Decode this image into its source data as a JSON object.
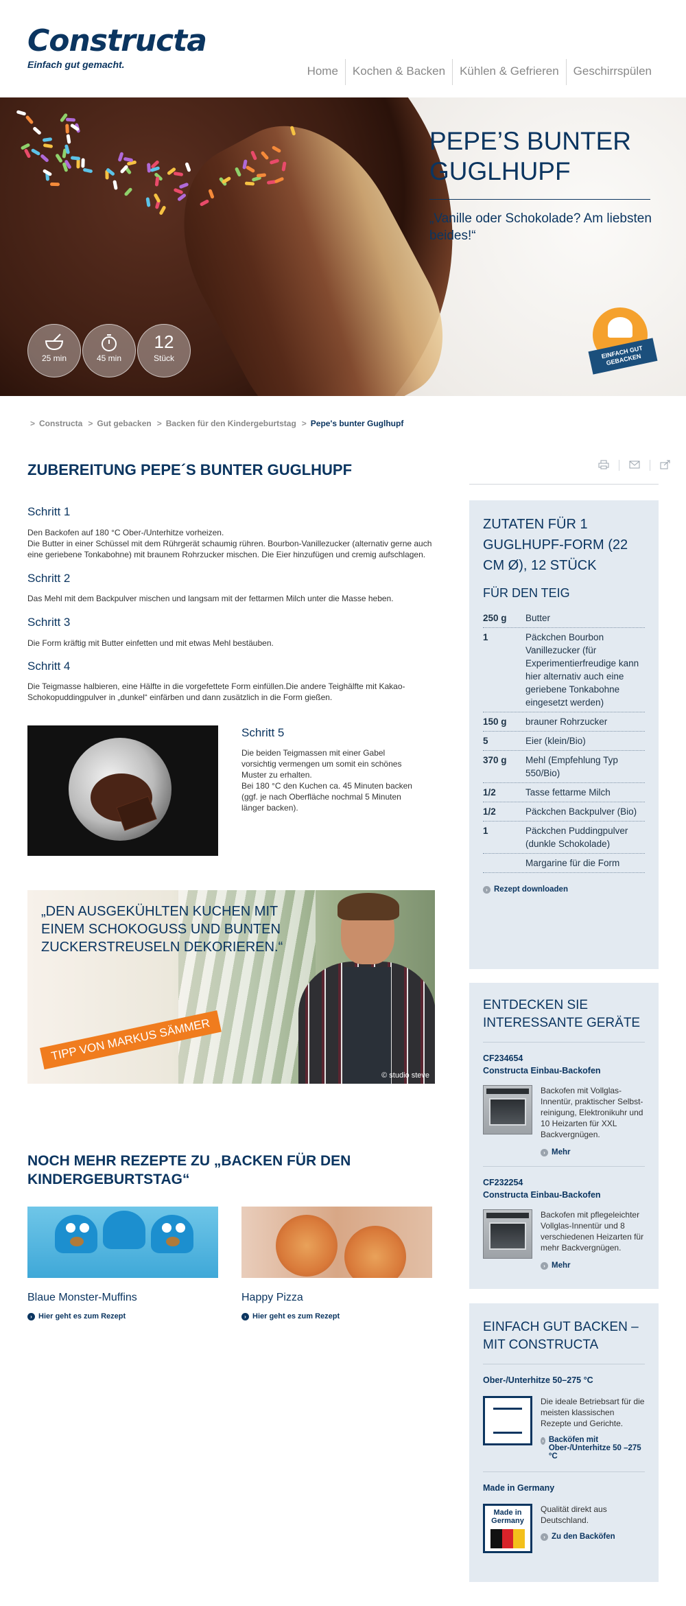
{
  "header": {
    "brand": "Constructa",
    "tagline": "Einfach gut gemacht.",
    "nav": [
      "Home",
      "Kochen & Backen",
      "Kühlen & Gefrieren",
      "Geschirrspülen"
    ]
  },
  "hero": {
    "title": "PEPE’S BUNTER GUGLHUPF",
    "quote": "„Vanille oder Schokolade? Am liebsten beides!“",
    "stats": [
      {
        "icon": "mixing-bowl-icon",
        "label": "25 min"
      },
      {
        "icon": "stopwatch-icon",
        "label": "45 min"
      },
      {
        "value": "12",
        "label": "Stück"
      }
    ],
    "badge": "EINFACH GUT GEBACKEN"
  },
  "breadcrumb": [
    "Constructa",
    "Gut gebacken",
    "Backen für den Kindergeburtstag",
    "Pepe's bunter Guglhupf"
  ],
  "preparation": {
    "title": "ZUBEREITUNG PEPE´S BUNTER GUGLHUPF",
    "steps": [
      {
        "heading": "Schritt 1",
        "text": "Den Backofen auf 180 °C Ober-/Unterhitze vorheizen.\nDie Butter in einer Schüssel mit dem Rührgerät schaumig rühren. Bourbon-Vanillezucker (alternativ gerne auch eine geriebene Tonkabohne) mit braunem Rohrzucker mischen. Die Eier hinzufügen und cremig aufschlagen."
      },
      {
        "heading": "Schritt 2",
        "text": "Das Mehl mit dem Backpulver mischen und langsam mit der fettarmen Milch unter die Masse heben."
      },
      {
        "heading": "Schritt 3",
        "text": "Die Form kräftig mit Butter einfetten und mit etwas Mehl bestäuben."
      },
      {
        "heading": "Schritt 4",
        "text": "Die Teigmasse halbieren, eine Hälfte in die vorgefettete Form einfüllen.Die andere Teighälfte mit Kakao-Schokopuddingpulver in „dunkel“ einfärben und dann zusätzlich in die Form gießen."
      },
      {
        "heading": "Schritt 5",
        "text": "Die beiden Teigmassen mit einer Gabel vorsichtig vermengen um somit ein schönes Muster zu erhalten.\nBei 180 °C den Kuchen ca. 45 Minuten backen (ggf. je nach Oberfläche nochmal 5 Minuten länger backen)."
      }
    ]
  },
  "tip": {
    "quote": "„DEN AUSGEKÜHLTEN KUCHEN MIT EINEM SCHOKOGUSS UND BUNTEN ZUCKERSTREUSELN DEKORIEREN.“",
    "label": "TIPP VON MARKUS SÄMMER",
    "credit": "© studio steve"
  },
  "more": {
    "title": "NOCH MEHR REZEPTE ZU „BACKEN FÜR DEN KINDERGEBURTSTAG“",
    "recipes": [
      {
        "title": "Blaue Monster-Muffins",
        "link": "Hier geht es zum Rezept"
      },
      {
        "title": "Happy Pizza",
        "link": "Hier geht es zum Rezept"
      }
    ]
  },
  "share_icons": [
    "print-icon",
    "mail-icon",
    "share-icon"
  ],
  "ingredients": {
    "title": "ZUTATEN FÜR 1 GUGLHUPF-FORM (22 CM Ø), 12 STÜCK",
    "subtitle": "FÜR DEN TEIG",
    "rows": [
      {
        "amount": "250 g",
        "name": "Butter"
      },
      {
        "amount": "1",
        "name": "Päckchen Bourbon Vanillezucker (für Experimentierfreudige kann hier alternativ auch eine geriebene Tonkabohne eingesetzt werden)"
      },
      {
        "amount": "150 g",
        "name": "brauner Rohrzucker"
      },
      {
        "amount": "5",
        "name": "Eier (klein/Bio)"
      },
      {
        "amount": "370 g",
        "name": "Mehl (Empfehlung Typ 550/Bio)"
      },
      {
        "amount": "1/2",
        "name": "Tasse fettarme Milch"
      },
      {
        "amount": "1/2",
        "name": "Päckchen Backpulver (Bio)"
      },
      {
        "amount": "1",
        "name": "Päckchen Puddingpulver (dunkle Schokolade)"
      },
      {
        "amount": "",
        "name": "Margarine für die Form"
      }
    ],
    "download": "Rezept downloaden"
  },
  "devices": {
    "title": "ENTDECKEN SIE INTERESSANTE GERÄTE",
    "items": [
      {
        "code": "CF234654",
        "name": "Constructa Einbau-Backofen",
        "desc": "Backofen mit Vollglas-Innentür, praktischer Selbst-reinigung, Elektronikuhr und 10 Heizarten für XXL Backvergnügen.",
        "link": "Mehr"
      },
      {
        "code": "CF232254",
        "name": "Constructa Einbau-Backofen",
        "desc": "Backofen mit pflegeleichter Vollglas-Innentür und 8 verschiedenen Heizarten für mehr Backvergnügen.",
        "link": "Mehr"
      }
    ]
  },
  "baking": {
    "title": "EINFACH GUT BACKEN – MIT CONSTRUCTA",
    "items": [
      {
        "heading": "Ober-/Unterhitze 50–275 °C",
        "desc": "Die ideale Betriebsart für die meisten klassischen Rezepte und Gerichte.",
        "link": "Backöfen mit Ober-/Unterhitze 50 –275 °C"
      },
      {
        "heading": "Made in Germany",
        "icon_text": "Made in Germany",
        "desc": "Qualität direkt aus Deutschland.",
        "link": "Zu den Backöfen"
      }
    ]
  },
  "colors": {
    "navy": "#0b3560",
    "sidebar_bg": "#e3eaf1",
    "accent_orange": "#f07c1e"
  }
}
